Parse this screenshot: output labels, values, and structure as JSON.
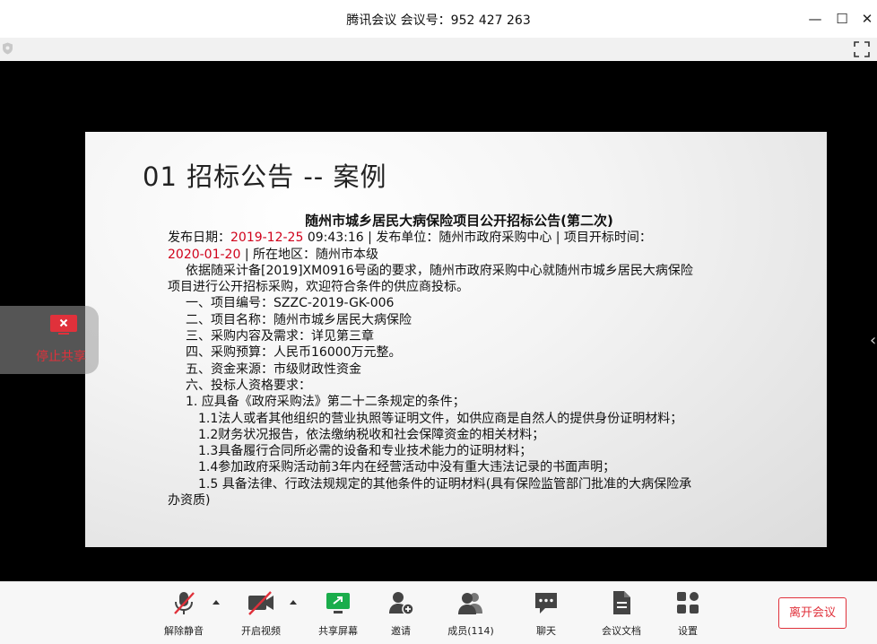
{
  "window": {
    "title": "腾讯会议 会议号：952 427 263"
  },
  "window_controls": {
    "minimize": "—",
    "maximize": "☐",
    "close": "✕"
  },
  "slide": {
    "title": "01 招标公告 -- 案例",
    "doc_title": "随州市城乡居民大病保险项目公开招标公告(第二次)",
    "line1_prefix": "发布日期：",
    "line1_date": "2019-12-25",
    "line1_rest": " 09:43:16 | 发布单位：随州市政府采购中心 | 项目开标时间：",
    "line2_date": "2020-01-20",
    "line2_rest": " | 所在地区：随州市本级",
    "para1": "依据随采计备[2019]XM0916号函的要求，随州市政府采购中心就随州市城乡居民大病保险",
    "para1b": "项目进行公开招标采购，欢迎符合条件的供应商投标。",
    "items": [
      "一、项目编号：SZZC-2019-GK-006",
      "二、项目名称：随州市城乡居民大病保险",
      "三、采购内容及需求：详见第三章",
      "四、采购预算：人民币16000万元整。",
      "五、资金来源：市级财政性资金",
      "六、投标人资格要求："
    ],
    "req_head": "1. 应具备《政府采购法》第二十二条规定的条件；",
    "reqs": [
      "1.1法人或者其他组织的营业执照等证明文件，如供应商是自然人的提供身份证明材料；",
      "1.2财务状况报告，依法缴纳税收和社会保障资金的相关材料；",
      "1.3具备履行合同所必需的设备和专业技术能力的证明材料；",
      "1.4参加政府采购活动前3年内在经营活动中没有重大违法记录的书面声明；",
      "1.5 具备法律、行政法规规定的其他条件的证明材料(具有保险监管部门批准的大病保险承"
    ],
    "req_tail": "办资质)"
  },
  "stop_share": {
    "label": "停止共享"
  },
  "toolbar": {
    "mute": "解除静音",
    "video": "开启视频",
    "share": "共享屏幕",
    "invite": "邀请",
    "members": "成员(114)",
    "chat": "聊天",
    "docs": "会议文档",
    "settings": "设置",
    "leave": "离开会议"
  },
  "colors": {
    "accent_red": "#e0313b",
    "date_red": "#d0021b",
    "share_green": "#1aad4b"
  }
}
